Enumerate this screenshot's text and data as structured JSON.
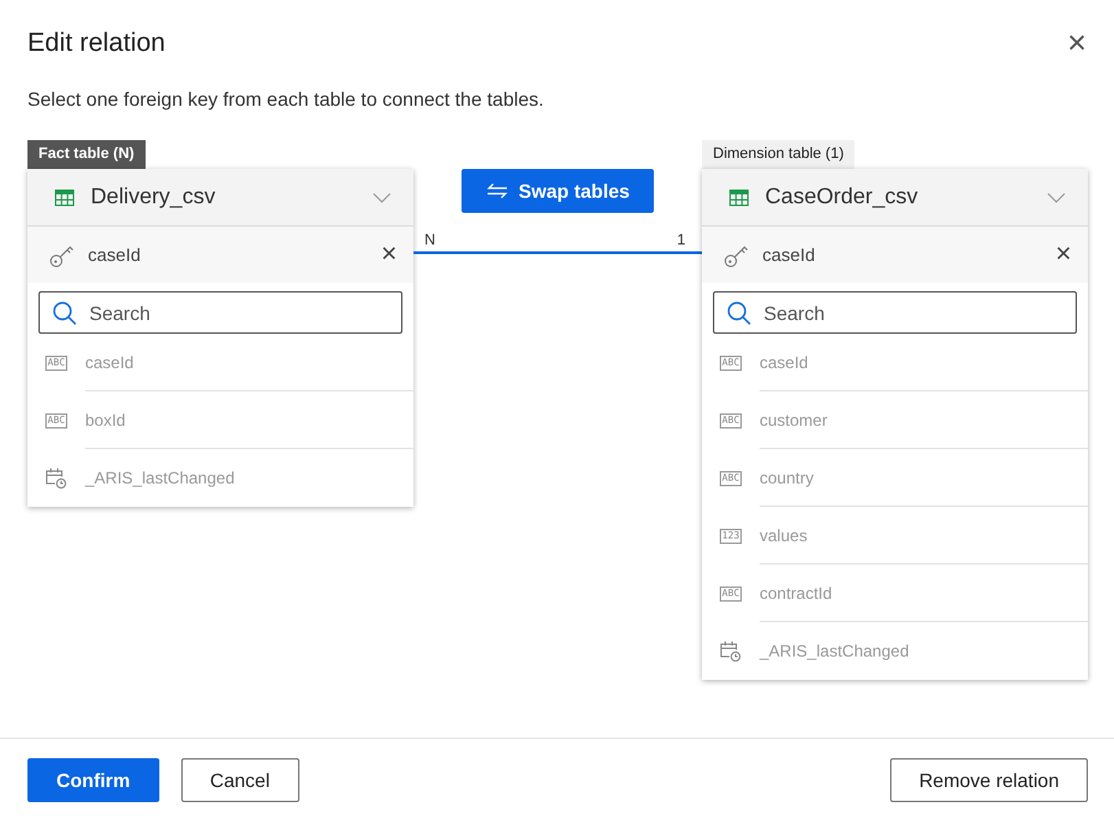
{
  "dialog": {
    "title": "Edit relation",
    "close": "×",
    "description": "Select one foreign key from each table to connect the tables."
  },
  "swap_button": "Swap tables",
  "relation": {
    "left_cardinality": "N",
    "right_cardinality": "1"
  },
  "tables": [
    {
      "tag": "Fact table (N)",
      "tag_highlighted": true,
      "name": "Delivery_csv",
      "key": "caseId",
      "search_placeholder": "Search",
      "fields": [
        {
          "kind": "text",
          "type_label": "ABC",
          "name": "caseId"
        },
        {
          "kind": "text",
          "type_label": "ABC",
          "name": "boxId"
        },
        {
          "kind": "date",
          "name": "_ARIS_lastChanged"
        }
      ]
    },
    {
      "tag": "Dimension table (1)",
      "tag_highlighted": false,
      "name": "CaseOrder_csv",
      "key": "caseId",
      "search_placeholder": "Search",
      "fields": [
        {
          "kind": "text",
          "type_label": "ABC",
          "name": "caseId"
        },
        {
          "kind": "text",
          "type_label": "ABC",
          "name": "customer"
        },
        {
          "kind": "text",
          "type_label": "ABC",
          "name": "country"
        },
        {
          "kind": "text",
          "type_label": "123",
          "name": "values"
        },
        {
          "kind": "text",
          "type_label": "ABC",
          "name": "contractId"
        },
        {
          "kind": "date",
          "name": "_ARIS_lastChanged"
        }
      ]
    }
  ],
  "footer": {
    "confirm": "Confirm",
    "cancel": "Cancel",
    "remove": "Remove relation"
  }
}
